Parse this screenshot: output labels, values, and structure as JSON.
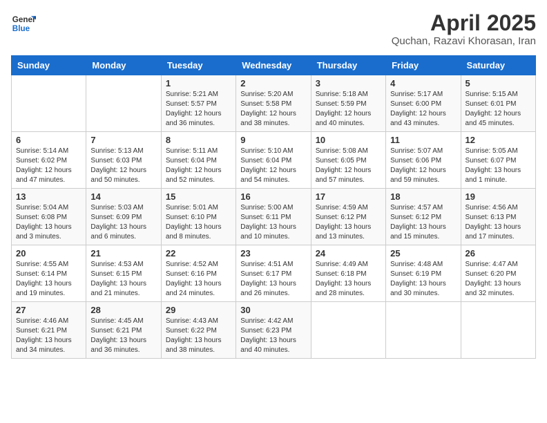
{
  "logo": {
    "general": "General",
    "blue": "Blue"
  },
  "title": "April 2025",
  "subtitle": "Quchan, Razavi Khorasan, Iran",
  "headers": [
    "Sunday",
    "Monday",
    "Tuesday",
    "Wednesday",
    "Thursday",
    "Friday",
    "Saturday"
  ],
  "weeks": [
    [
      {
        "day": "",
        "info": ""
      },
      {
        "day": "",
        "info": ""
      },
      {
        "day": "1",
        "info": "Sunrise: 5:21 AM\nSunset: 5:57 PM\nDaylight: 12 hours and 36 minutes."
      },
      {
        "day": "2",
        "info": "Sunrise: 5:20 AM\nSunset: 5:58 PM\nDaylight: 12 hours and 38 minutes."
      },
      {
        "day": "3",
        "info": "Sunrise: 5:18 AM\nSunset: 5:59 PM\nDaylight: 12 hours and 40 minutes."
      },
      {
        "day": "4",
        "info": "Sunrise: 5:17 AM\nSunset: 6:00 PM\nDaylight: 12 hours and 43 minutes."
      },
      {
        "day": "5",
        "info": "Sunrise: 5:15 AM\nSunset: 6:01 PM\nDaylight: 12 hours and 45 minutes."
      }
    ],
    [
      {
        "day": "6",
        "info": "Sunrise: 5:14 AM\nSunset: 6:02 PM\nDaylight: 12 hours and 47 minutes."
      },
      {
        "day": "7",
        "info": "Sunrise: 5:13 AM\nSunset: 6:03 PM\nDaylight: 12 hours and 50 minutes."
      },
      {
        "day": "8",
        "info": "Sunrise: 5:11 AM\nSunset: 6:04 PM\nDaylight: 12 hours and 52 minutes."
      },
      {
        "day": "9",
        "info": "Sunrise: 5:10 AM\nSunset: 6:04 PM\nDaylight: 12 hours and 54 minutes."
      },
      {
        "day": "10",
        "info": "Sunrise: 5:08 AM\nSunset: 6:05 PM\nDaylight: 12 hours and 57 minutes."
      },
      {
        "day": "11",
        "info": "Sunrise: 5:07 AM\nSunset: 6:06 PM\nDaylight: 12 hours and 59 minutes."
      },
      {
        "day": "12",
        "info": "Sunrise: 5:05 AM\nSunset: 6:07 PM\nDaylight: 13 hours and 1 minute."
      }
    ],
    [
      {
        "day": "13",
        "info": "Sunrise: 5:04 AM\nSunset: 6:08 PM\nDaylight: 13 hours and 3 minutes."
      },
      {
        "day": "14",
        "info": "Sunrise: 5:03 AM\nSunset: 6:09 PM\nDaylight: 13 hours and 6 minutes."
      },
      {
        "day": "15",
        "info": "Sunrise: 5:01 AM\nSunset: 6:10 PM\nDaylight: 13 hours and 8 minutes."
      },
      {
        "day": "16",
        "info": "Sunrise: 5:00 AM\nSunset: 6:11 PM\nDaylight: 13 hours and 10 minutes."
      },
      {
        "day": "17",
        "info": "Sunrise: 4:59 AM\nSunset: 6:12 PM\nDaylight: 13 hours and 13 minutes."
      },
      {
        "day": "18",
        "info": "Sunrise: 4:57 AM\nSunset: 6:12 PM\nDaylight: 13 hours and 15 minutes."
      },
      {
        "day": "19",
        "info": "Sunrise: 4:56 AM\nSunset: 6:13 PM\nDaylight: 13 hours and 17 minutes."
      }
    ],
    [
      {
        "day": "20",
        "info": "Sunrise: 4:55 AM\nSunset: 6:14 PM\nDaylight: 13 hours and 19 minutes."
      },
      {
        "day": "21",
        "info": "Sunrise: 4:53 AM\nSunset: 6:15 PM\nDaylight: 13 hours and 21 minutes."
      },
      {
        "day": "22",
        "info": "Sunrise: 4:52 AM\nSunset: 6:16 PM\nDaylight: 13 hours and 24 minutes."
      },
      {
        "day": "23",
        "info": "Sunrise: 4:51 AM\nSunset: 6:17 PM\nDaylight: 13 hours and 26 minutes."
      },
      {
        "day": "24",
        "info": "Sunrise: 4:49 AM\nSunset: 6:18 PM\nDaylight: 13 hours and 28 minutes."
      },
      {
        "day": "25",
        "info": "Sunrise: 4:48 AM\nSunset: 6:19 PM\nDaylight: 13 hours and 30 minutes."
      },
      {
        "day": "26",
        "info": "Sunrise: 4:47 AM\nSunset: 6:20 PM\nDaylight: 13 hours and 32 minutes."
      }
    ],
    [
      {
        "day": "27",
        "info": "Sunrise: 4:46 AM\nSunset: 6:21 PM\nDaylight: 13 hours and 34 minutes."
      },
      {
        "day": "28",
        "info": "Sunrise: 4:45 AM\nSunset: 6:21 PM\nDaylight: 13 hours and 36 minutes."
      },
      {
        "day": "29",
        "info": "Sunrise: 4:43 AM\nSunset: 6:22 PM\nDaylight: 13 hours and 38 minutes."
      },
      {
        "day": "30",
        "info": "Sunrise: 4:42 AM\nSunset: 6:23 PM\nDaylight: 13 hours and 40 minutes."
      },
      {
        "day": "",
        "info": ""
      },
      {
        "day": "",
        "info": ""
      },
      {
        "day": "",
        "info": ""
      }
    ]
  ]
}
